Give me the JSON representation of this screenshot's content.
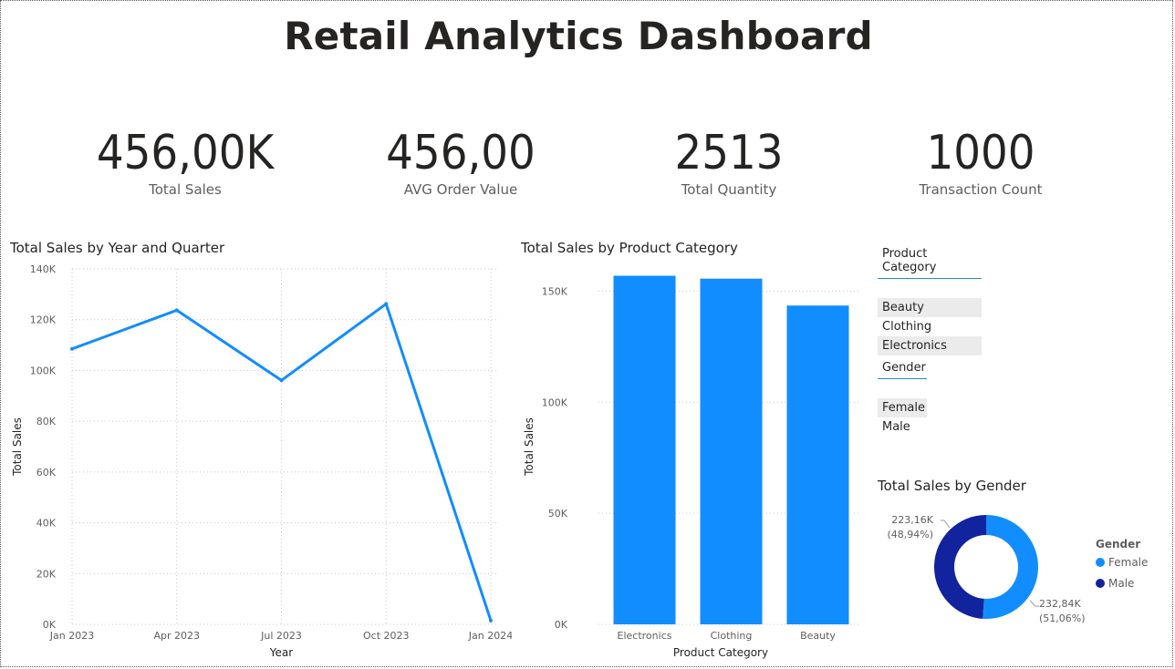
{
  "title": "Retail Analytics Dashboard",
  "kpis": [
    {
      "value": "456,00K",
      "label": "Total Sales"
    },
    {
      "value": "456,00",
      "label": "AVG Order Value"
    },
    {
      "value": "2513",
      "label": "Total Quantity"
    },
    {
      "value": "1000",
      "label": "Transaction Count"
    }
  ],
  "slicers": {
    "product_category": {
      "header": "Product Category",
      "items": [
        {
          "label": "Beauty",
          "selected": true
        },
        {
          "label": "Clothing",
          "selected": false
        },
        {
          "label": "Electronics",
          "selected": true
        }
      ]
    },
    "gender": {
      "header": "Gender",
      "items": [
        {
          "label": "Female",
          "selected": true
        },
        {
          "label": "Male",
          "selected": false
        }
      ]
    }
  },
  "colors": {
    "primary": "#118dff",
    "male": "#12239e",
    "gridline": "#c8c6c4",
    "text": "#252423",
    "subtext": "#605e5c"
  },
  "chart_data": [
    {
      "type": "line",
      "title": "Total Sales by Year and Quarter",
      "xlabel": "Year",
      "ylabel": "Total Sales",
      "x": [
        "Jan 2023",
        "Apr 2023",
        "Jul 2023",
        "Oct 2023",
        "Jan 2024"
      ],
      "y_tick_labels": [
        "0K",
        "20K",
        "40K",
        "60K",
        "80K",
        "100K",
        "120K",
        "140K"
      ],
      "ylim": [
        0,
        140000
      ],
      "series": [
        {
          "values": [
            108500,
            123700,
            96100,
            126200,
            1500
          ]
        }
      ],
      "grid": true
    },
    {
      "type": "bar",
      "title": "Total Sales by Product Category",
      "xlabel": "Product Category",
      "ylabel": "Total Sales",
      "categories": [
        "Electronics",
        "Clothing",
        "Beauty"
      ],
      "values": [
        156900,
        155600,
        143500
      ],
      "y_tick_labels": [
        "0K",
        "50K",
        "100K",
        "150K"
      ],
      "ylim": [
        0,
        160000
      ],
      "grid": true
    },
    {
      "type": "pie",
      "title": "Total Sales by Gender",
      "legend_title": "Gender",
      "legend": "right",
      "slices": [
        {
          "name": "Female",
          "value": 232840,
          "label": "232,84K",
          "pct_label": "(51,06%)"
        },
        {
          "name": "Male",
          "value": 223160,
          "label": "223,16K",
          "pct_label": "(48,94%)"
        }
      ]
    }
  ]
}
